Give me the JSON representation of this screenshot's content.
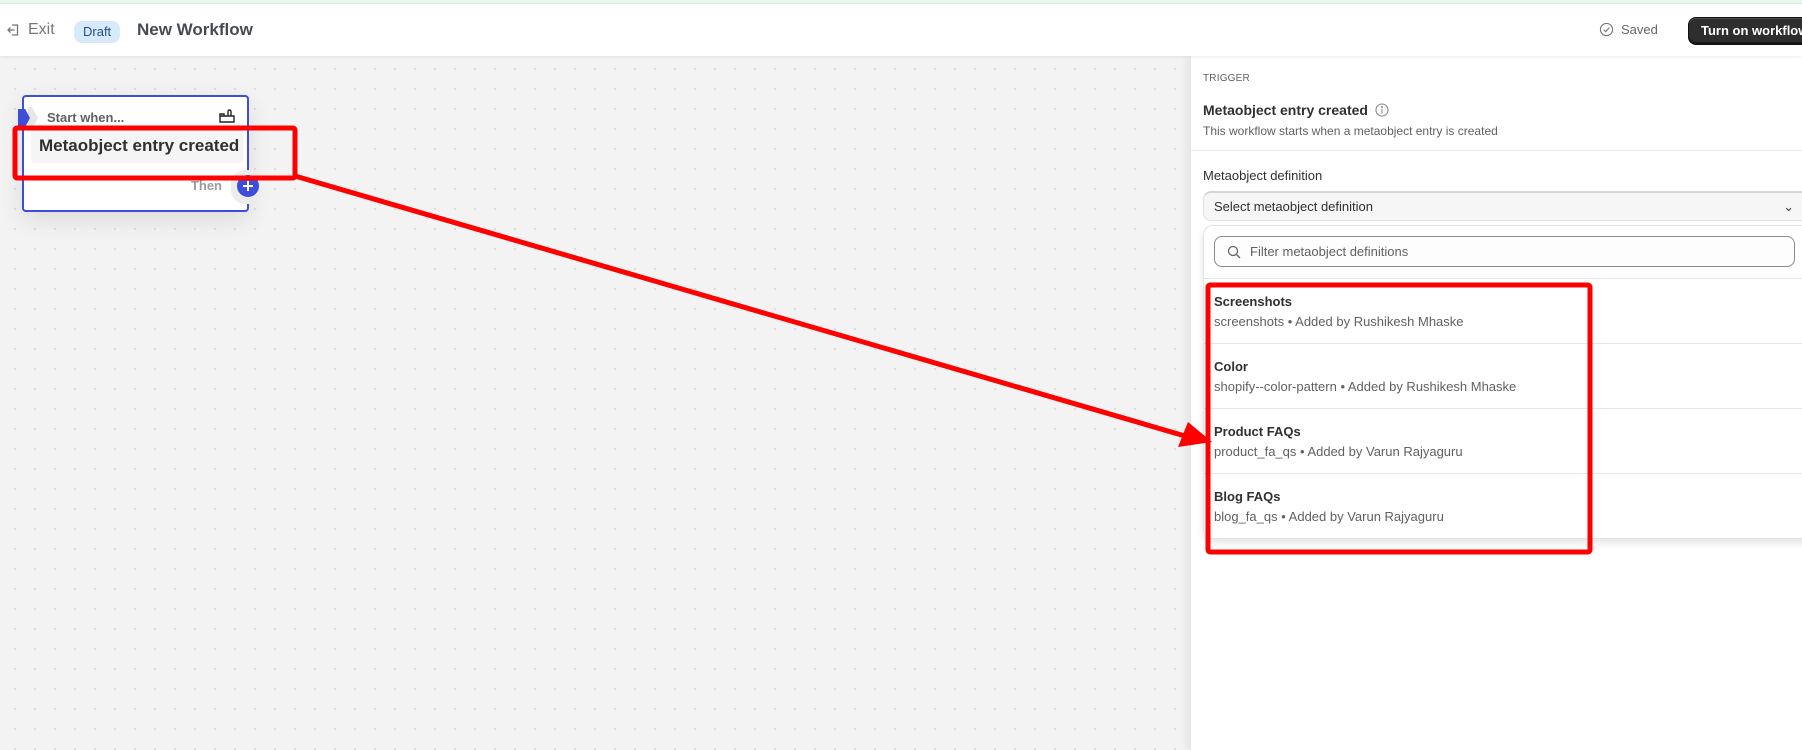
{
  "header": {
    "exit_label": "Exit",
    "status_badge": "Draft",
    "title": "New Workflow",
    "saved_label": "Saved",
    "turn_on_label": "Turn on workflow"
  },
  "canvas": {
    "node": {
      "start_label": "Start when...",
      "trigger_name": "Metaobject entry created",
      "then_label": "Then",
      "icon": "shop-icon"
    }
  },
  "panel": {
    "kicker": "TRIGGER",
    "title": "Metaobject entry created",
    "description": "This workflow starts when a metaobject entry is created",
    "field_label": "Metaobject definition",
    "select_placeholder": "Select metaobject definition",
    "filter_placeholder": "Filter metaobject definitions",
    "options": [
      {
        "name": "Screenshots",
        "subtitle": "screenshots • Added by Rushikesh Mhaske"
      },
      {
        "name": "Color",
        "subtitle": "shopify--color-pattern • Added by Rushikesh Mhaske"
      },
      {
        "name": "Product FAQs",
        "subtitle": "product_fa_qs • Added by Varun Rajyaguru"
      },
      {
        "name": "Blog FAQs",
        "subtitle": "blog_fa_qs • Added by Varun Rajyaguru"
      }
    ]
  },
  "annotation": {
    "color": "#ff0000"
  }
}
